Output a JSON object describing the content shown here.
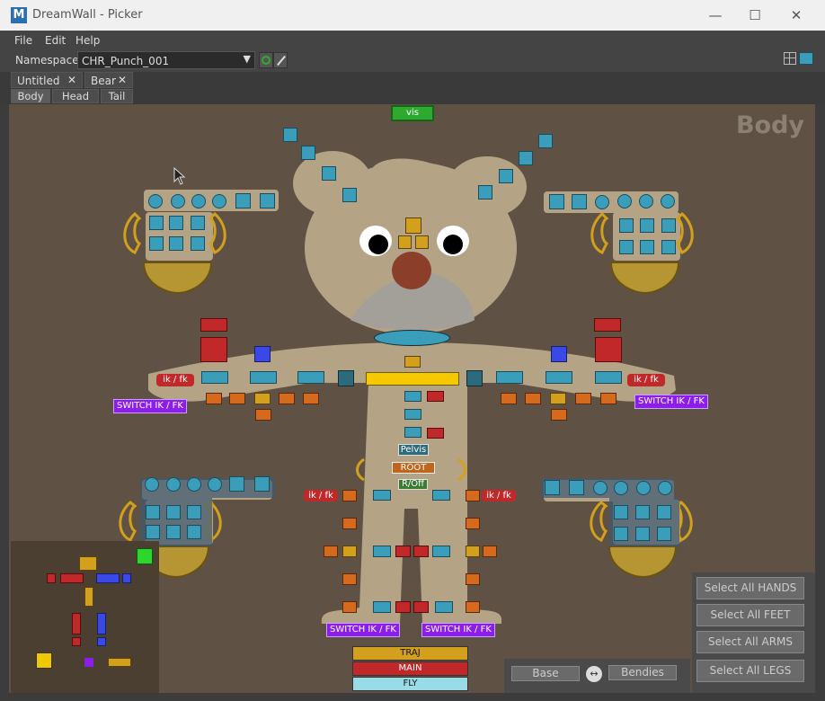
{
  "window": {
    "title": "DreamWall - Picker",
    "app_glyph": "M",
    "minimize": "—",
    "maximize": "☐",
    "close": "✕"
  },
  "menu": {
    "file": "File",
    "edit": "Edit",
    "help": "Help"
  },
  "namespace": {
    "label": "Namespace:",
    "value": "CHR_Punch_001",
    "arrow": "▼"
  },
  "tabs": [
    {
      "label": "Untitled",
      "close": "✕"
    },
    {
      "label": "Bear",
      "close": "✕"
    }
  ],
  "subtabs": [
    "Body",
    "Head",
    "Tail"
  ],
  "canvas": {
    "title": "Body",
    "vis": "vis",
    "ikfk": "ik / fk",
    "switch": "SWITCH IK / FK",
    "pelvis": "Pelvis",
    "root": "ROOT",
    "roff": "R/Off",
    "traj": "TRAJ",
    "main": "MAIN",
    "fly": "FLY",
    "base": "Base",
    "swap": "↔",
    "bendies": "Bendies"
  },
  "select_buttons": [
    "Select All HANDS",
    "Select All FEET",
    "Select All ARMS",
    "Select All LEGS"
  ],
  "colors": {
    "body": "#b5a386",
    "ear": "#b09c7c",
    "ctrl_cyan": "#3a9ebb",
    "ctrl_orange": "#d66a1c",
    "ctrl_yellow": "#d2a01c",
    "ctrl_red": "#c0282a",
    "ctrl_blue": "#3a48e8",
    "switch_purple": "#8b1ee8",
    "vis_green": "#2eaa2e"
  }
}
